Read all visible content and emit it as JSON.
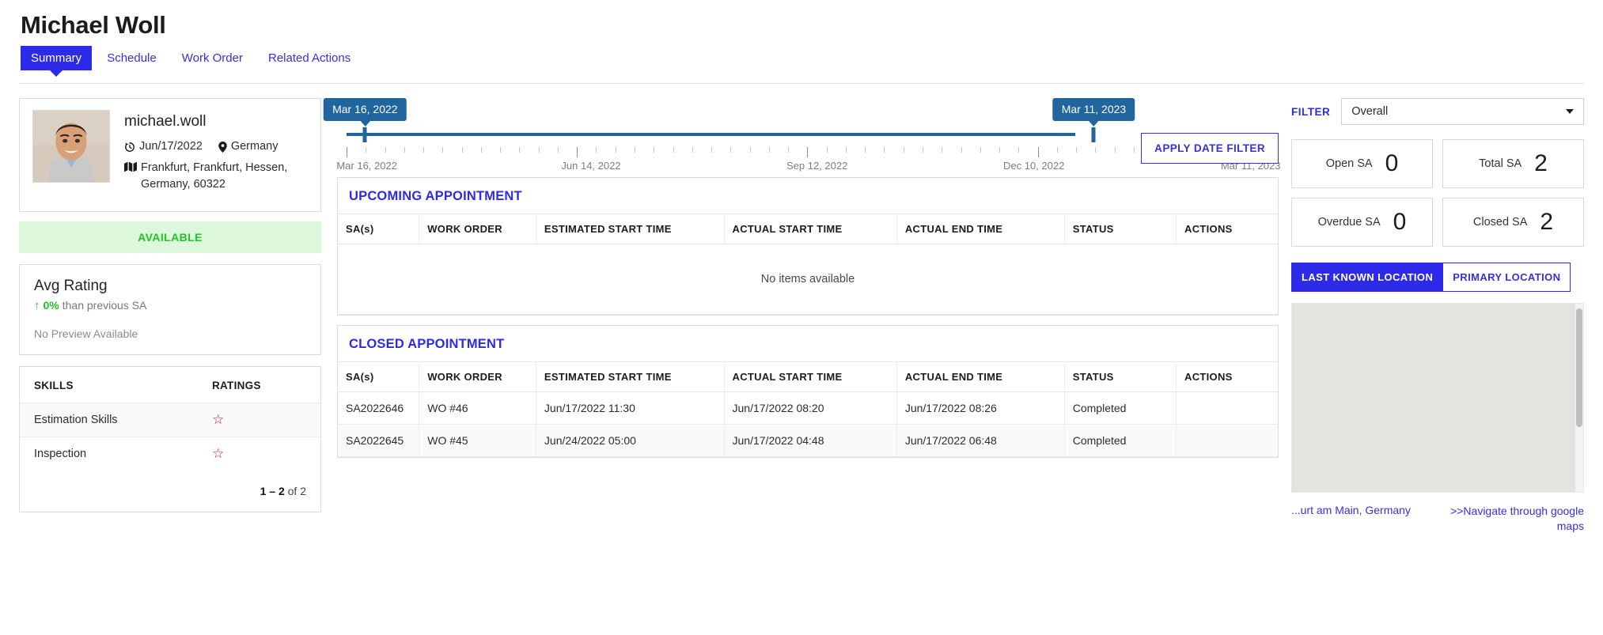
{
  "header": {
    "title": "Michael Woll",
    "tabs": [
      {
        "label": "Summary",
        "active": true
      },
      {
        "label": "Schedule",
        "active": false
      },
      {
        "label": "Work Order",
        "active": false
      },
      {
        "label": "Related Actions",
        "active": false
      }
    ]
  },
  "profile": {
    "username": "michael.woll",
    "joined_date": "Jun/17/2022",
    "country": "Germany",
    "address": "Frankfurt, Frankfurt, Hessen, Germany, 60322",
    "status": "AVAILABLE",
    "status_color": "#22c522"
  },
  "rating": {
    "title": "Avg Rating",
    "delta": "0%",
    "delta_suffix": "than previous SA",
    "preview": "No Preview Available"
  },
  "skills": {
    "columns": [
      "SKILLS",
      "RATINGS"
    ],
    "rows": [
      {
        "name": "Estimation Skills",
        "stars": 1
      },
      {
        "name": "Inspection",
        "stars": 1
      }
    ],
    "pager_range": "1 – 2",
    "pager_of": "of 2"
  },
  "slider": {
    "left_bubble": "Mar 16, 2022",
    "right_bubble": "Mar 11, 2023",
    "axis_labels": [
      "Mar 16, 2022",
      "Jun 14, 2022",
      "Sep 12, 2022",
      "Dec 10, 2022",
      "Mar 11, 2023"
    ],
    "apply_label": "APPLY DATE FILTER"
  },
  "upcoming": {
    "title": "UPCOMING APPOINTMENT",
    "columns": [
      "SA(s)",
      "WORK ORDER",
      "ESTIMATED START TIME",
      "ACTUAL START TIME",
      "ACTUAL END TIME",
      "STATUS",
      "ACTIONS"
    ],
    "empty_text": "No items available",
    "rows": []
  },
  "closed": {
    "title": "CLOSED APPOINTMENT",
    "columns": [
      "SA(s)",
      "WORK ORDER",
      "ESTIMATED START TIME",
      "ACTUAL START TIME",
      "ACTUAL END TIME",
      "STATUS",
      "ACTIONS"
    ],
    "rows": [
      {
        "sa": "SA2022646",
        "work_order": "WO #46",
        "estimated_start": "Jun/17/2022 11:30",
        "actual_start": "Jun/17/2022 08:20",
        "actual_end": "Jun/17/2022 08:26",
        "status": "Completed",
        "actions": ""
      },
      {
        "sa": "SA2022645",
        "work_order": "WO #45",
        "estimated_start": "Jun/24/2022 05:00",
        "actual_start": "Jun/17/2022 04:48",
        "actual_end": "Jun/17/2022 06:48",
        "status": "Completed",
        "actions": ""
      }
    ]
  },
  "sidebar": {
    "filter_label": "FILTER",
    "filter_value": "Overall",
    "stats": [
      {
        "label": "Open SA",
        "value": "0"
      },
      {
        "label": "Total SA",
        "value": "2"
      },
      {
        "label": "Overdue SA",
        "value": "0"
      },
      {
        "label": "Closed SA",
        "value": "2"
      }
    ],
    "location_buttons": [
      {
        "label": "LAST KNOWN LOCATION",
        "active": true
      },
      {
        "label": "PRIMARY LOCATION",
        "active": false
      }
    ],
    "map_address": "...urt am Main, Germany",
    "map_navigate": ">>Navigate through google maps"
  },
  "colors": {
    "accent_blue": "#2d2ae8",
    "link_blue": "#3531e0",
    "slider_blue": "#21659e",
    "success_green": "#3da63d",
    "star_red": "#d6173a"
  }
}
